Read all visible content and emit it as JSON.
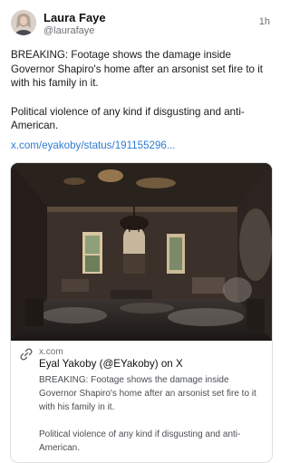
{
  "author": {
    "name": "Laura Faye",
    "handle": "@laurafaye",
    "timestamp": "1h"
  },
  "post": {
    "paragraphs": [
      "BREAKING: Footage shows the damage inside Governor Shapiro's home after an arsonist set fire to it with his family in it.",
      "Political violence of any kind if disgusting and anti-American."
    ],
    "link_text": "x.com/eyakoby/status/191155296..."
  },
  "link_card": {
    "domain": "x.com",
    "title": "Eyal Yakoby (@EYakoby) on X",
    "description": [
      "BREAKING: Footage shows the damage inside Governor Shapiro's home after an arsonist set fire to it with his family in it.",
      "Political violence of any kind if disgusting and anti-American."
    ],
    "icons": {
      "link": "link-icon"
    }
  },
  "colors": {
    "link": "#2f7bd0",
    "secondary_text": "#6b6f74",
    "card_border": "#dcdfe3"
  }
}
